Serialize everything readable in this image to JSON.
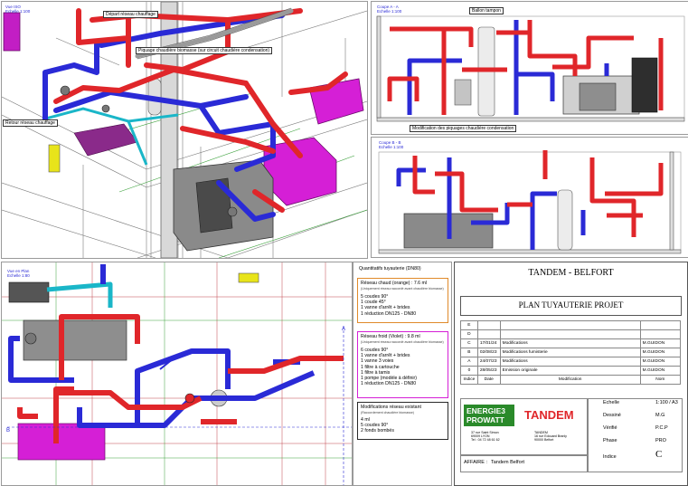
{
  "views": {
    "iso": {
      "tag_line1": "Vue ISO",
      "tag_line2": "Echelle 1:100",
      "labels": {
        "depart": "Départ réseau chauffage",
        "piquage": "Piquage chaudière biomasse (sur circuit chaudière condensation)",
        "retour": "Retour réseau chauffage"
      }
    },
    "coupe_a": {
      "tag_line1": "Coupe A - A",
      "tag_line2": "Echelle 1:100",
      "labels": {
        "ballon": "Ballon tampon",
        "modif": "Modification des piquages chaudière condensation"
      }
    },
    "coupe_b": {
      "tag_line1": "Coupe B - B",
      "tag_line2": "Echelle 1:100"
    },
    "plan": {
      "tag_line1": "Vue en Plan",
      "tag_line2": "Echelle 1:80",
      "marker_a": "A",
      "marker_b": "B"
    }
  },
  "legend": {
    "title": "Quantitatifs tuyauterie (DN80)",
    "chaud": {
      "title": "Réseau chaud (orange) : 7.6 ml",
      "note": "(Uniquement réseau raccordé avant chaudière biomasse)",
      "items": [
        "5 coudes 90°",
        "1 coude 45°",
        "1 vanne d'arrêt + brides",
        "1 réduction DN125 - DN80"
      ]
    },
    "froid": {
      "title": "Réseau froid (Violet) : 9.8 ml",
      "note": "(Uniquement réseau raccordé avant chaudière biomasse)",
      "items": [
        "6 coudes 90°",
        "1 vanne d'arrêt + brides",
        "1 vanne 3 voies",
        "1 filtre à cartouche",
        "1 filtre à tamis",
        "1 pompe (modèle à définir)",
        "1 réduction DN125 - DN80"
      ]
    },
    "modif": {
      "title": "Modifications réseau existant",
      "note": "(Raccordement chaudière biomasse)",
      "items": [
        "4 ml",
        "5 coudes 90°",
        "2 fonds bombés"
      ]
    }
  },
  "title_block": {
    "project": "TANDEM - BELFORT",
    "drawing": "PLAN TUYAUTERIE PROJET",
    "revisions": [
      {
        "ind": "E",
        "date": "",
        "mod": "",
        "nom": ""
      },
      {
        "ind": "D",
        "date": "",
        "mod": "",
        "nom": ""
      },
      {
        "ind": "C",
        "date": "17/01/24",
        "mod": "Modifications",
        "nom": "M.GUIDON"
      },
      {
        "ind": "B",
        "date": "02/08/23",
        "mod": "Modifications fumisterie",
        "nom": "M.GUIDON"
      },
      {
        "ind": "A",
        "date": "24/07/23",
        "mod": "Modifications",
        "nom": "M.GUIDON"
      },
      {
        "ind": "0",
        "date": "28/05/23",
        "mod": "Emission originale",
        "nom": "M.GUIDON"
      }
    ],
    "rev_headers": {
      "ind": "Indice",
      "date": "Date",
      "mod": "Modification",
      "nom": "Nom"
    },
    "logo1_line1": "ENERGIE3",
    "logo1_line2": "PROWATT",
    "logo1_addr": [
      "37 rue Saint Simon",
      "69009 LYON",
      "Tel : 04 72 48 61 62"
    ],
    "logo2": "TANDEM",
    "logo2_addr": [
      "TANDEM",
      "16 rue Edouard Branly",
      "90000 Belfort"
    ],
    "fields": [
      {
        "k": "Echelle",
        "v": "1:100 / A3"
      },
      {
        "k": "Dessiné",
        "v": "M.G"
      },
      {
        "k": "Vérifié",
        "v": "P.C.P"
      },
      {
        "k": "Phase",
        "v": "PRO"
      },
      {
        "k": "Indice",
        "v": "C"
      }
    ],
    "affaire_label": "AFFAIRE :",
    "affaire_value": "Tandem Belfort"
  },
  "colors": {
    "hot": "#e0262a",
    "cold": "#2a2ad6",
    "teal": "#1ab6c8",
    "magenta": "#d51fd6",
    "grey_equipment": "#8a8a8a",
    "grid_red": "#c0424a",
    "grid_green": "#3aa03a"
  }
}
